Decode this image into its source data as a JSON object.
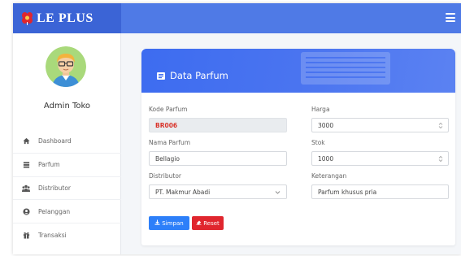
{
  "brand": {
    "name": "LE PLUS",
    "logo_icon": "flower-logo-icon",
    "menu_icon": "hamburger-icon"
  },
  "colors": {
    "topbar": "#4f7ae6",
    "brand_bg": "#3b64d6",
    "accent": "#3d6cf0",
    "save": "#2d7ff9",
    "reset": "#e0262e",
    "code": "#d9342b"
  },
  "sidebar": {
    "user_name": "Admin Toko",
    "avatar_icon": "user-avatar",
    "items": [
      {
        "label": "Dashboard",
        "icon": "home-icon"
      },
      {
        "label": "Parfum",
        "icon": "list-icon"
      },
      {
        "label": "Distributor",
        "icon": "users-icon"
      },
      {
        "label": "Pelanggan",
        "icon": "user-group-icon"
      },
      {
        "label": "Transaksi",
        "icon": "gift-icon"
      }
    ]
  },
  "form": {
    "title": "Data Parfum",
    "title_icon": "id-card-icon",
    "kode_label": "Kode Parfum",
    "kode_value": "BR006",
    "nama_label": "Nama Parfum",
    "nama_value": "Bellagio",
    "distributor_label": "Distributor",
    "distributor_value": "PT. Makmur Abadi",
    "harga_label": "Harga",
    "harga_value": "3000",
    "stok_label": "Stok",
    "stok_value": "1000",
    "keterangan_label": "Keterangan",
    "keterangan_value": "Parfum khusus pria",
    "save_label": "Simpan",
    "save_icon": "download-icon",
    "reset_label": "Reset",
    "reset_icon": "eraser-icon"
  }
}
